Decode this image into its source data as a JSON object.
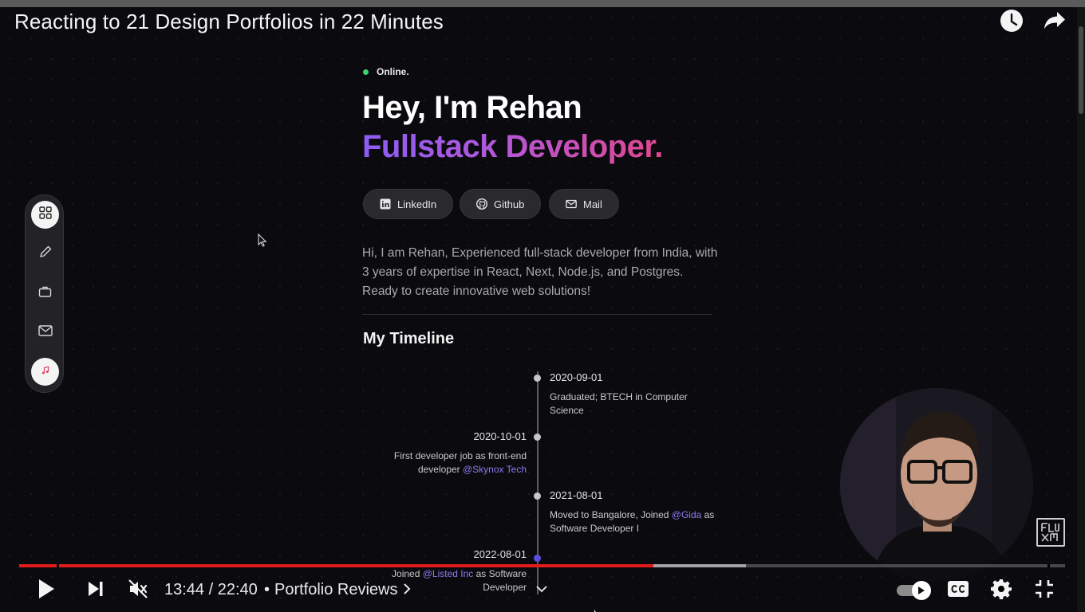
{
  "video": {
    "title": "Reacting to 21 Design Portfolios in 22 Minutes",
    "current_time": "13:44",
    "duration": "22:40",
    "time_display": "13:44 / 22:40",
    "separator": "•",
    "chapter_title": "Portfolio Reviews",
    "progress_played_fraction": 0.606,
    "progress_buffered_fraction": 0.695,
    "accent_color": "#e31b1b"
  },
  "icons": {
    "watch_later": "clock-icon",
    "share": "share-arrow-icon",
    "play": "play-icon",
    "next": "skip-next-icon",
    "mute": "muted-speaker-icon",
    "autoplay": "autoplay-toggle-icon",
    "captions": "cc-icon",
    "settings": "gear-icon",
    "exit_fullscreen": "exit-fullscreen-icon"
  },
  "portfolio": {
    "status": "Online.",
    "hero_line1_prefix": "Hey, I'm ",
    "hero_name": "Rehan",
    "hero_line2": "Fullstack Developer.",
    "social_buttons": [
      {
        "label": "LinkedIn",
        "icon": "linkedin-icon"
      },
      {
        "label": "Github",
        "icon": "github-icon"
      },
      {
        "label": "Mail",
        "icon": "mail-icon"
      }
    ],
    "bio": "Hi, I am Rehan, Experienced full-stack developer from India, with 3 years of expertise in React, Next, Node.js, and Postgres. Ready to create innovative web solutions!",
    "timeline_heading": "My Timeline",
    "timeline": [
      {
        "date": "2020-09-01",
        "text": "Graduated; BTECH in Computer Science",
        "side": "right"
      },
      {
        "date": "2020-10-01",
        "text_before": "First developer job as front-end developer ",
        "highlight": "@Skynox Tech",
        "text_after": "",
        "side": "left"
      },
      {
        "date": "2021-08-01",
        "text_before": "Moved to Bangalore, Joined ",
        "highlight": "@Gida",
        "text_after": " as Software Developer I",
        "side": "right"
      },
      {
        "date": "2022-08-01",
        "text_before": "Joined ",
        "highlight": "@Listed Inc",
        "text_after": " as Software Developer",
        "side": "left"
      }
    ]
  },
  "dock": {
    "items": [
      "grid-icon",
      "pencil-icon",
      "briefcase-icon",
      "mail-icon",
      "music-note-icon"
    ]
  },
  "watermark": {
    "text": "FLUX"
  }
}
